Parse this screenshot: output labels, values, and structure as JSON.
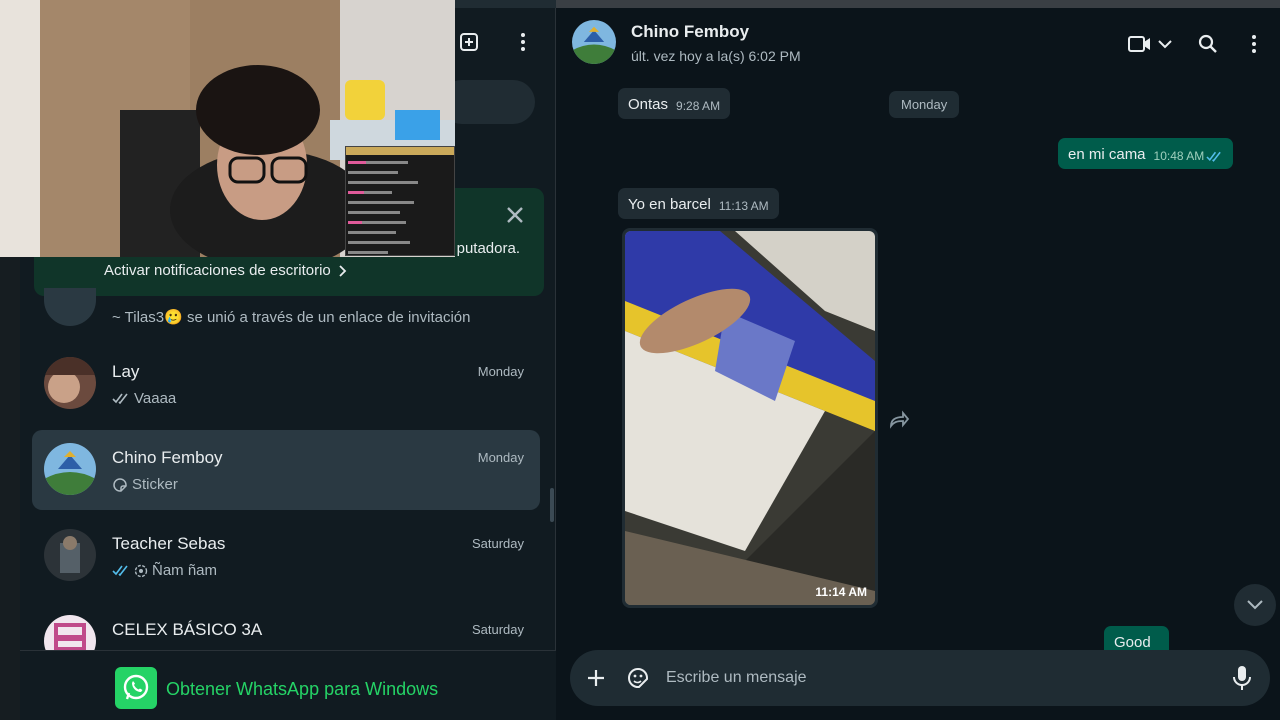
{
  "sidebar": {
    "notification": {
      "description": "putadora.",
      "link": "Activar notificaciones de escritorio"
    },
    "join_message": "~ Tilas3🥲 se unió a través de un enlace de invitación",
    "chats": [
      {
        "name": "Lay",
        "time": "Monday",
        "preview": "Vaaaa",
        "status": "read-gray"
      },
      {
        "name": "Chino Femboy",
        "time": "Monday",
        "preview": "Sticker",
        "status": "sticker"
      },
      {
        "name": "Teacher Sebas",
        "time": "Saturday",
        "preview": "Ñam ñam",
        "status": "read-blue"
      },
      {
        "name": "CELEX BÁSICO 3A",
        "time": "Saturday",
        "preview": "",
        "status": ""
      }
    ],
    "get_app_label": "Obtener WhatsApp para Windows"
  },
  "chat": {
    "title": "Chino Femboy",
    "subtitle": "últ. vez hoy a la(s) 6:02 PM",
    "day_chip": "Monday",
    "messages": [
      {
        "dir": "in",
        "text": "Ontas",
        "time": "9:28 AM"
      },
      {
        "dir": "out",
        "text": "en mi cama",
        "time": "10:48 AM"
      },
      {
        "dir": "in",
        "text": "Yo en barcel",
        "time": "11:13 AM"
      },
      {
        "dir": "in",
        "text": "",
        "time": "11:14 AM",
        "type": "photo"
      },
      {
        "dir": "out",
        "text": "Good",
        "time": ""
      }
    ],
    "composer_placeholder": "Escribe un mensaje"
  },
  "colors": {
    "accent": "#25d366",
    "outgoing_bubble": "#005c4b",
    "incoming_bubble": "#202c33",
    "read_tick": "#53bdeb"
  },
  "icons": [
    "new-chat-icon",
    "menu-icon",
    "close-icon",
    "chevron-right-icon",
    "video-call-icon",
    "chevron-down-icon",
    "search-icon",
    "forward-icon",
    "plus-icon",
    "sticker-icon",
    "mic-icon",
    "whatsapp-logo"
  ]
}
